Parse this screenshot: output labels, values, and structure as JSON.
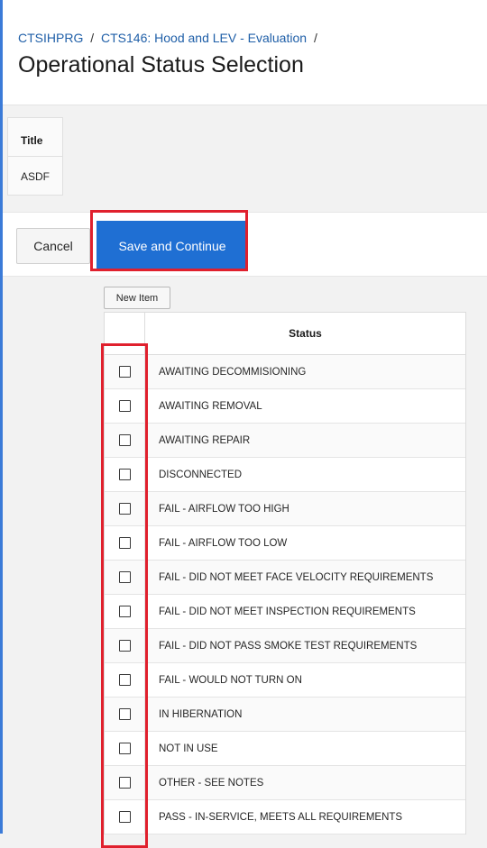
{
  "breadcrumb": {
    "items": [
      "CTSIHPRG",
      "CTS146: Hood and LEV - Evaluation"
    ],
    "separator": "/"
  },
  "page": {
    "title": "Operational Status Selection"
  },
  "info": {
    "title_label": "Title",
    "title_value": "ASDF"
  },
  "buttons": {
    "cancel": "Cancel",
    "save": "Save and Continue",
    "new_item": "New Item"
  },
  "grid": {
    "column_header": "Status",
    "rows": [
      "AWAITING DECOMMISIONING",
      "AWAITING REMOVAL",
      "AWAITING REPAIR",
      "DISCONNECTED",
      "FAIL - AIRFLOW TOO HIGH",
      "FAIL - AIRFLOW TOO LOW",
      "FAIL - DID NOT MEET FACE VELOCITY REQUIREMENTS",
      "FAIL - DID NOT MEET INSPECTION REQUIREMENTS",
      "FAIL - DID NOT PASS SMOKE TEST REQUIREMENTS",
      "FAIL - WOULD NOT TURN ON",
      "IN HIBERNATION",
      "NOT IN USE",
      "OTHER - SEE NOTES",
      "PASS - IN-SERVICE, MEETS ALL REQUIREMENTS"
    ]
  },
  "colors": {
    "accent": "#1f6fd3",
    "link": "#1f5fa8",
    "highlight": "#e0202d"
  }
}
